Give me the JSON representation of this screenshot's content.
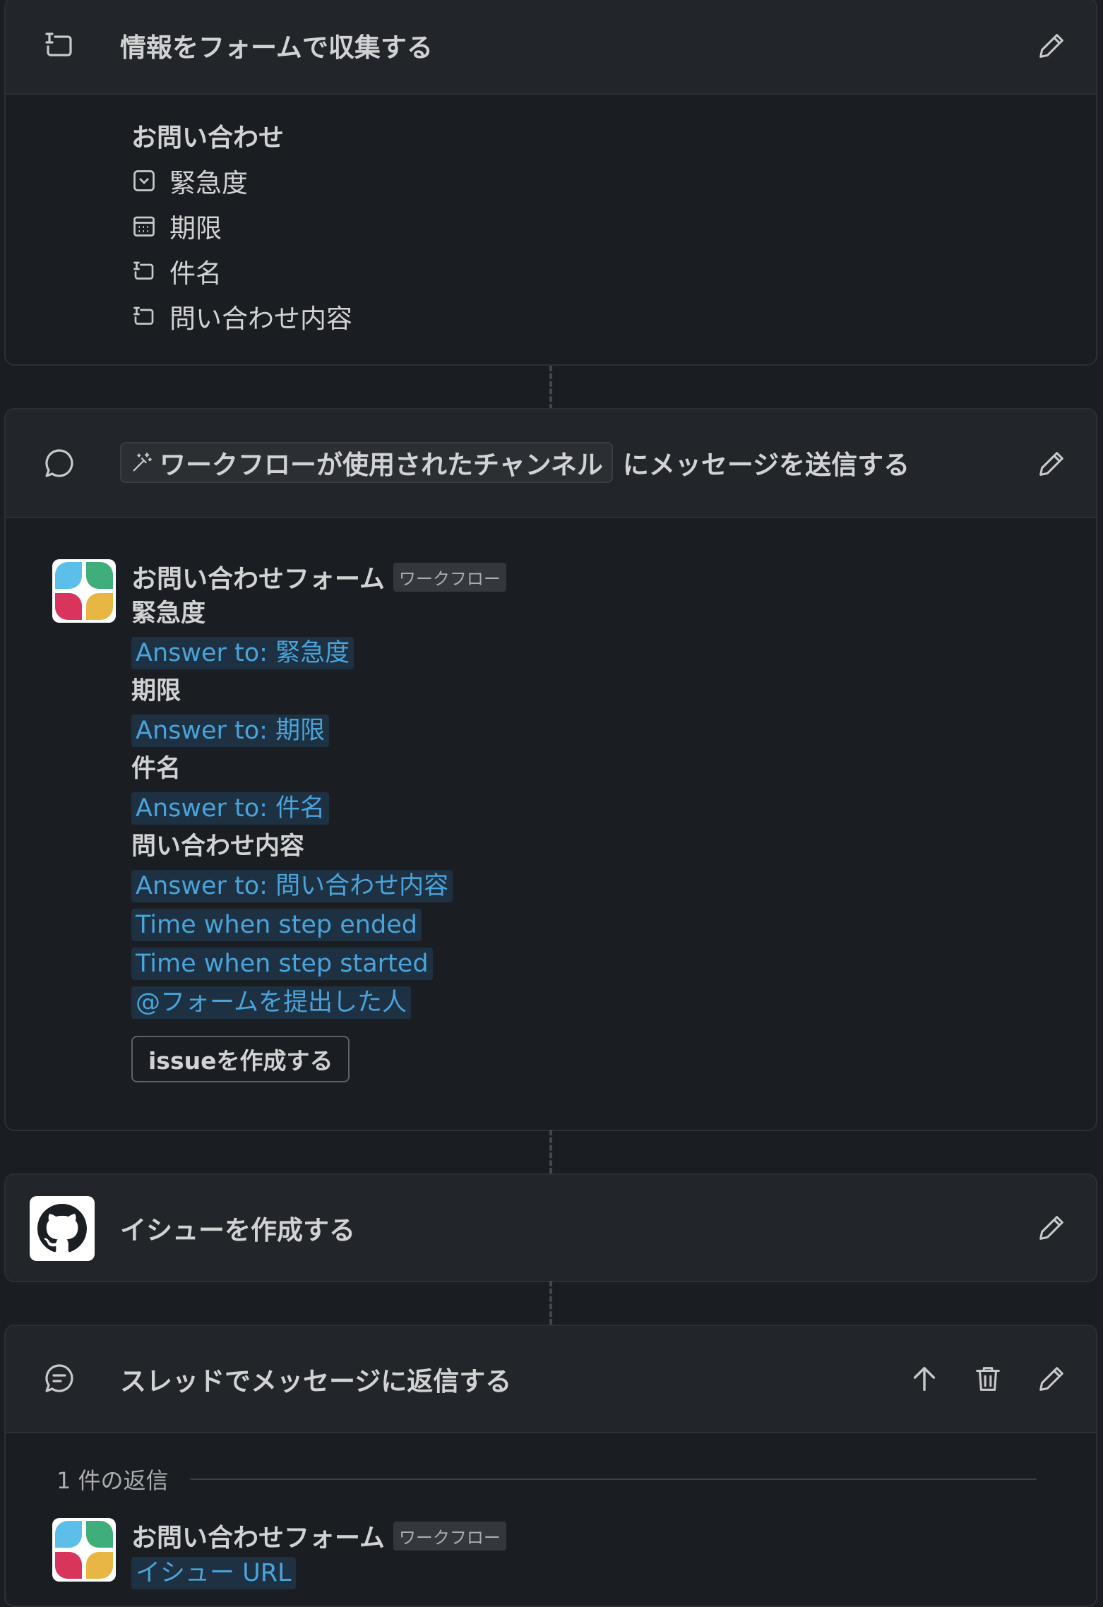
{
  "step1": {
    "title": "情報をフォームで収集する",
    "form_title": "お問い合わせ",
    "fields": [
      {
        "icon": "dropdown-icon",
        "label": "緊急度"
      },
      {
        "icon": "calendar-icon",
        "label": "期限"
      },
      {
        "icon": "text-field-icon",
        "label": "件名"
      },
      {
        "icon": "text-field-icon",
        "label": "問い合わせ内容"
      }
    ]
  },
  "step2": {
    "chip_label": "ワークフローが使用されたチャンネル",
    "title_suffix": "にメッセージを送信する",
    "sender": "お問い合わせフォーム",
    "badge": "ワークフロー",
    "labels": [
      "緊急度",
      "期限",
      "件名",
      "問い合わせ内容"
    ],
    "answers": [
      "Answer to: 緊急度",
      "Answer to: 期限",
      "Answer to: 件名",
      "Answer to: 問い合わせ内容"
    ],
    "extra_vars": [
      "Time when step ended",
      "Time when step started",
      "@フォームを提出した人"
    ],
    "button_label": "issueを作成する"
  },
  "step3": {
    "title": "イシューを作成する"
  },
  "step4": {
    "title": "スレッドでメッセージに返信する",
    "replies_label": "1 件の返信",
    "sender": "お問い合わせフォーム",
    "badge": "ワークフロー",
    "var": "イシュー URL"
  },
  "colors": {
    "background": "#1a1d21",
    "card_header": "#222529",
    "variable_text": "#4aa3d9",
    "variable_bg": "#1d3143",
    "avatar_colors": [
      "#5bbfea",
      "#3fae7b",
      "#d9345c",
      "#e8b642"
    ]
  }
}
